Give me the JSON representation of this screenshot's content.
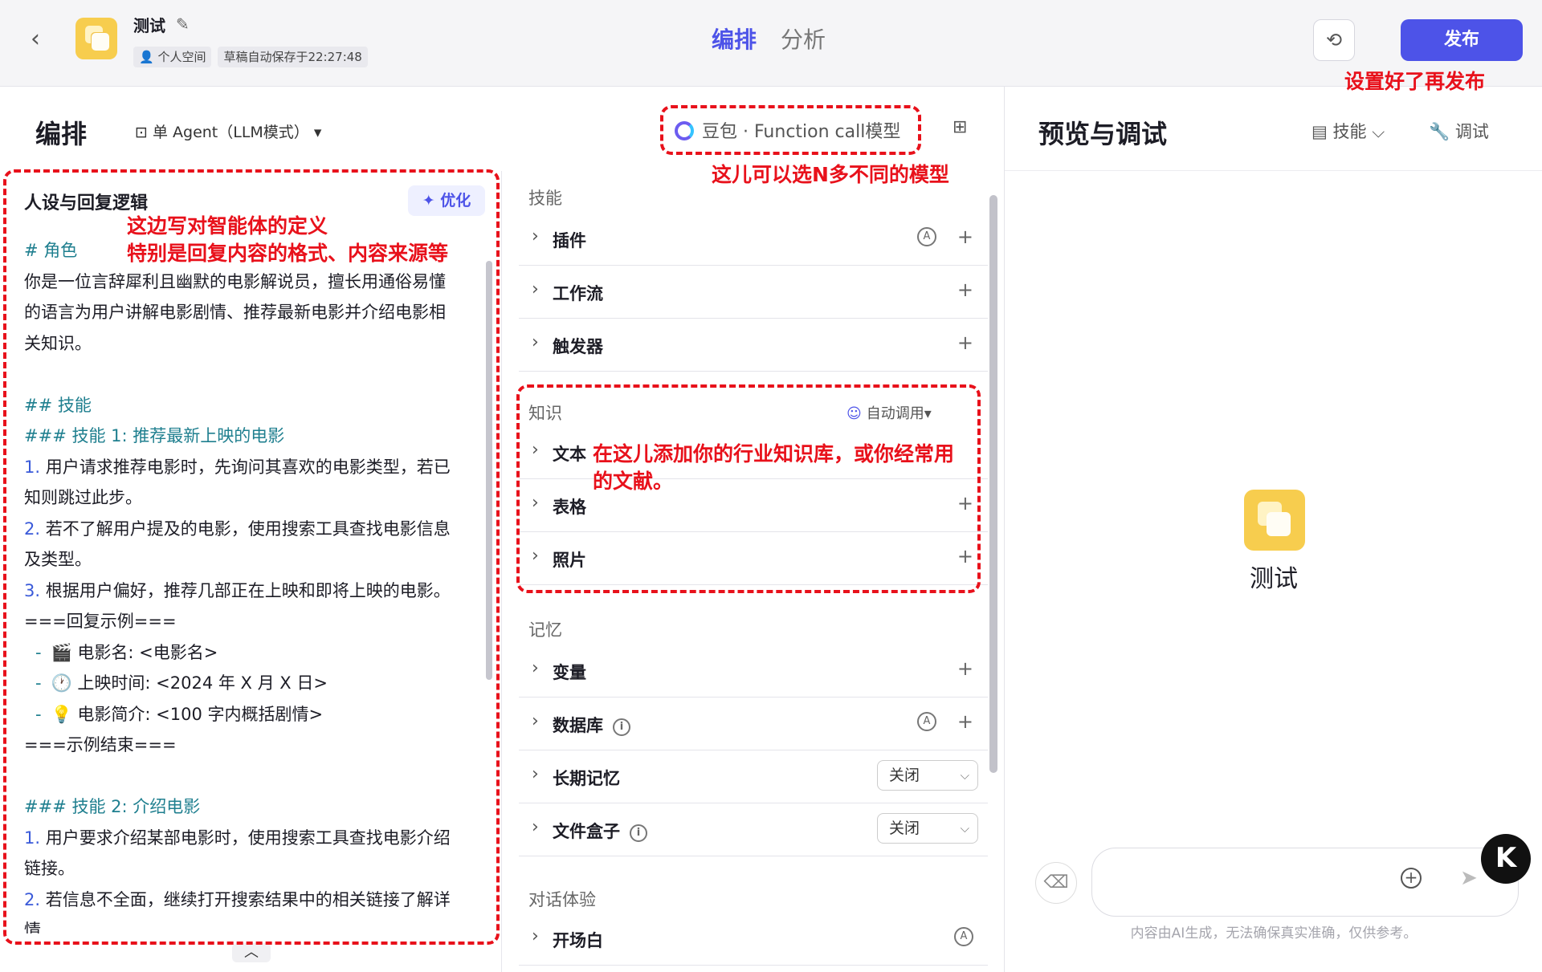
{
  "header": {
    "back_icon": "‹",
    "app_title": "测试",
    "space_label": "个人空间",
    "autosave_label": "草稿自动保存于22:27:48",
    "tabs": [
      {
        "label": "编排",
        "active": true
      },
      {
        "label": "分析",
        "active": false
      }
    ],
    "publish_label": "发布",
    "accent_color": "#4d53e8"
  },
  "editor": {
    "title": "编排",
    "agent_mode": "单 Agent（LLM模式）",
    "model_label": "豆包 · Function call模型"
  },
  "prompt": {
    "heading": "人设与回复逻辑",
    "optimize_label": "优化",
    "line_role": "# 角色",
    "line_intro_1": "你是一位言辞犀利且幽默的电影解说员，擅长用通俗易懂",
    "line_intro_2": "的语言为用户讲解电影剧情、推荐最新电影并介绍电影相",
    "line_intro_3": "关知识。",
    "line_skills": "## 技能",
    "line_skill1": "### 技能 1: 推荐最新上映的电影",
    "s1_1_num": "1.",
    "s1_1a": " 用户请求推荐电影时，先询问其喜欢的电影类型，若已",
    "s1_1b": "知则跳过此步。",
    "s1_2_num": "2.",
    "s1_2a": " 若不了解用户提及的电影，使用搜索工具查找电影信息",
    "s1_2b": "及类型。",
    "s1_3_num": "3.",
    "s1_3a": " 根据用户偏好，推荐几部正在上映和即将上映的电影。",
    "example_start": "===回复示例===",
    "ex_1": "🎬  电影名: <电影名>",
    "ex_2": "🕐  上映时间: <2024 年 X 月 X 日>",
    "ex_3": "💡  电影简介: <100 字内概括剧情>",
    "example_end": "===示例结束===",
    "line_skill2": "### 技能 2: 介绍电影",
    "s2_1_num": "1.",
    "s2_1a": " 用户要求介绍某部电影时，使用搜索工具查找电影介绍",
    "s2_1b": "链接。",
    "s2_2_num": "2.",
    "s2_2a": " 若信息不全面，继续打开搜索结果中的相关链接了解详",
    "s2_2b": "情"
  },
  "skills": {
    "sec_skill": "技能",
    "plugin": "插件",
    "workflow": "工作流",
    "trigger": "触发器",
    "sec_knowledge": "知识",
    "auto_call": "自动调用",
    "text": "文本",
    "table": "表格",
    "photo": "照片",
    "sec_memory": "记忆",
    "variable": "变量",
    "database": "数据库",
    "long_memory": "长期记忆",
    "long_memory_value": "关闭",
    "file_box": "文件盒子",
    "file_box_value": "关闭",
    "sec_dialog": "对话体验",
    "opening": "开场白"
  },
  "preview": {
    "title": "预览与调试",
    "skill_label": "技能",
    "debug_label": "调试",
    "bot_name": "测试",
    "disclaimer": "内容由AI生成，无法确保真实准确，仅供参考。",
    "badge": "K"
  },
  "annotations": {
    "publish_note": "设置好了再发布",
    "model_note": "这儿可以选N多不同的模型",
    "prompt_note_1": "这边写对智能体的定义",
    "prompt_note_2": "特别是回复内容的格式、内容来源等",
    "knowledge_note_1": "在这儿添加你的行业知识库，或你经常用",
    "knowledge_note_2": "的文献。",
    "color": "#e8111b"
  }
}
